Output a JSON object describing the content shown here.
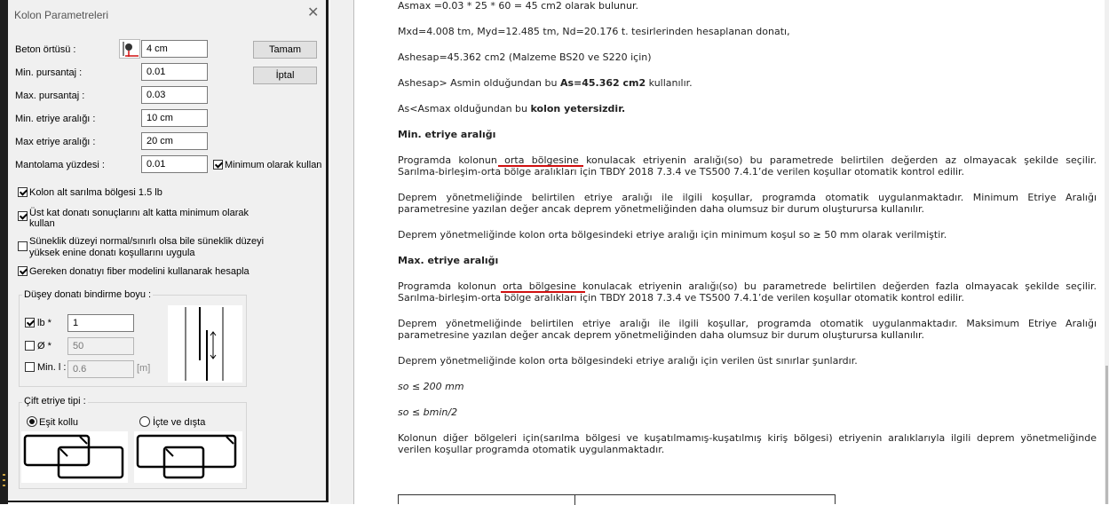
{
  "dialog": {
    "title": "Kolon Parametreleri",
    "close_glyph": "✕",
    "fields": [
      {
        "label": "Beton örtüsü :",
        "value": "4 cm"
      },
      {
        "label": "Min.  pursantaj :",
        "value": "0.01"
      },
      {
        "label": "Max. pursantaj :",
        "value": "0.03"
      },
      {
        "label": "Min. etriye aralığı :",
        "value": "10 cm"
      },
      {
        "label": "Max etriye aralığı :",
        "value": "20 cm"
      },
      {
        "label": "Mantolama yüzdesi :",
        "value": "0.01"
      }
    ],
    "ok_button": "Tamam",
    "cancel_button": "İptal",
    "min_use_checkbox": {
      "label": "Minimum olarak kullan",
      "checked": true
    },
    "options": [
      {
        "label": "Kolon alt sarılma bölgesi 1.5 lb",
        "checked": true
      },
      {
        "label_line1": "Üst kat donatı sonuçlarını alt katta minimum olarak",
        "label_line2": "kullan",
        "checked": true
      },
      {
        "label_line1": "Süneklik düzeyi normal/sınırlı olsa bile süneklik düzeyi",
        "label_line2": "yüksek enine donatı koşullarını uygula",
        "checked": false
      },
      {
        "label": "Gereken donatıyı fiber modelini kullanarak hesapla",
        "checked": true
      }
    ],
    "splice_group": {
      "title": "Düşey donatı bindirme boyu :",
      "rows": [
        {
          "label": "lb *",
          "value": "1",
          "checked": true,
          "unit": ""
        },
        {
          "label": "Ø *",
          "value": "50",
          "checked": false,
          "unit": ""
        },
        {
          "label": "Min. l :",
          "value": "0.6",
          "checked": false,
          "unit": "[m]"
        }
      ]
    },
    "stirrup_group": {
      "title": "Çift etriye tipi :",
      "options": [
        {
          "label": "Eşit kollu",
          "selected": true
        },
        {
          "label": "İçte ve dışta",
          "selected": false
        }
      ]
    }
  },
  "document": {
    "lines": [
      {
        "text": "Asmax =0.03 * 25 * 60 = 45 cm2 olarak bulunur."
      },
      {
        "text": "Mxd=4.008 tm, Myd=12.485 tm, Nd=20.176 t. tesirlerinden hesaplanan donatı,"
      },
      {
        "text": "Ashesap=45.362 cm2 (Malzeme BS20 ve S220 için)"
      },
      {
        "pre": "Ashesap> Asmin olduğundan bu ",
        "bold": "As=45.362 cm2",
        "post": " kullanılır."
      },
      {
        "pre": "As<Asmax olduğundan bu ",
        "bold": "kolon yetersizdir.",
        "post": ""
      }
    ],
    "heading_min": "Min. etriye aralığı",
    "min_para1_line1": "Programda kolonun orta bölgesine konulacak etriyenin aralığı(so) bu parametrede belirtilen değerden az olmayacak şekilde seçilir.",
    "min_para1_line2": "Sarılma-birleşim-orta bölge aralıkları için TBDY 2018 7.3.4 ve TS500 7.4.1’de verilen koşullar otomatik kontrol edilir.",
    "min_para2_line1": "Deprem yönetmeliğinde belirtilen etriye aralığı ile ilgili koşullar, programda otomatik uygulanmaktadır. Minimum Etriye Aralığı",
    "min_para2_line2": "parametresine yazılan değer ancak deprem yönetmeliğinden daha olumsuz bir durum oluşturursa kullanılır.",
    "min_para3": "Deprem yönetmeliğinde kolon orta bölgesindeki etriye aralığı için minimum koşul  so ≥ 50 mm olarak  verilmiştir.",
    "heading_max": "Max. etriye aralığı",
    "max_para1_line1": "Programda kolonun orta bölgesine konulacak etriyenin aralığı(so) bu parametrede belirtilen değerden fazla olmayacak şekilde seçilir.",
    "max_para1_line2": "Sarılma-birleşim-orta bölge aralıkları için TBDY 2018 7.3.4 ve TS500 7.4.1’de verilen koşullar otomatik kontrol edilir.",
    "max_para2_line1": "Deprem yönetmeliğinde belirtilen etriye aralığı ile ilgili koşullar, programda otomatik uygulanmaktadır. Maksimum Etriye Aralığı",
    "max_para2_line2": "parametresine yazılan değer ancak deprem yönetmeliğinden daha olumsuz bir durum oluşturursa kullanılır.",
    "max_para3": "Deprem yönetmeliğinde kolon orta bölgesindeki etriye aralığı için verilen üst sınırlar şunlardır.",
    "formula1": "so ≤ 200 mm",
    "formula2": "so ≤ bmin/2",
    "last_para_line1": "Kolonun diğer bölgeleri için(sarılma bölgesi ve kuşatılmamış-kuşatılmış kiriş bölgesi) etriyenin aralıklarıyla ilgili deprem yönetmeliğinde",
    "last_para_line2": "verilen koşullar programda otomatik uygulanmaktadır."
  },
  "colors": {
    "underline": "#d01010",
    "dialog_bg": "#f0f0f0"
  }
}
